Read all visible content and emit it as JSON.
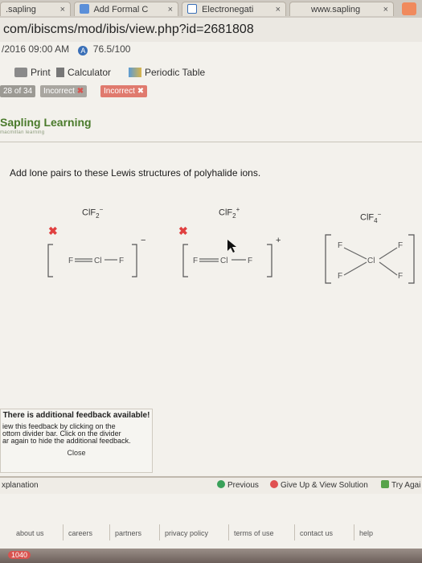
{
  "tabs": [
    {
      "label": ".sapling",
      "close": "×"
    },
    {
      "label": "Add Formal C",
      "close": "×"
    },
    {
      "label": "Electronegati",
      "close": "×"
    },
    {
      "label": "www.sapling",
      "close": "×"
    }
  ],
  "address": "com/ibiscms/mod/ibis/view.php?id=2681808",
  "top": {
    "date": "/2016 09:00 AM",
    "score": "76.5/100",
    "timer_badge": "A"
  },
  "toolbar": {
    "print": "Print",
    "calculator": "Calculator",
    "periodic_table": "Periodic Table"
  },
  "nav": {
    "counter": "28 of 34",
    "status1": "Incorrect",
    "status2": "Incorrect"
  },
  "brand": {
    "name": "Sapling Learning",
    "sub": "macmillan learning"
  },
  "question": "Add lone pairs to these Lewis structures of polyhalide ions.",
  "structures": [
    {
      "formula": "ClF",
      "sub": "2",
      "sup": "−",
      "charge": "−"
    },
    {
      "formula": "ClF",
      "sub": "2",
      "sup": "+",
      "charge": "+"
    },
    {
      "formula": "ClF",
      "sub": "4",
      "sup": "−",
      "charge": ""
    }
  ],
  "atoms": {
    "f": "F",
    "cl": "Cl"
  },
  "feedback": {
    "title": "There is additional feedback available!",
    "line1": "iew this feedback by clicking on the",
    "line2": "ottom divider bar. Click on the divider",
    "line3": "ar again to hide the additional feedback.",
    "close": "Close"
  },
  "bottom": {
    "explanation": "xplanation",
    "previous": "Previous",
    "give_up": "Give Up & View Solution",
    "try_again": "Try Agai"
  },
  "footer": [
    "about us",
    "careers",
    "partners",
    "privacy policy",
    "terms of use",
    "contact us",
    "help"
  ],
  "dock_badge": "1040",
  "colors": {
    "incorrect": "#d9534f",
    "brand": "#4a7a2b",
    "accent": "#3a6fb7"
  }
}
